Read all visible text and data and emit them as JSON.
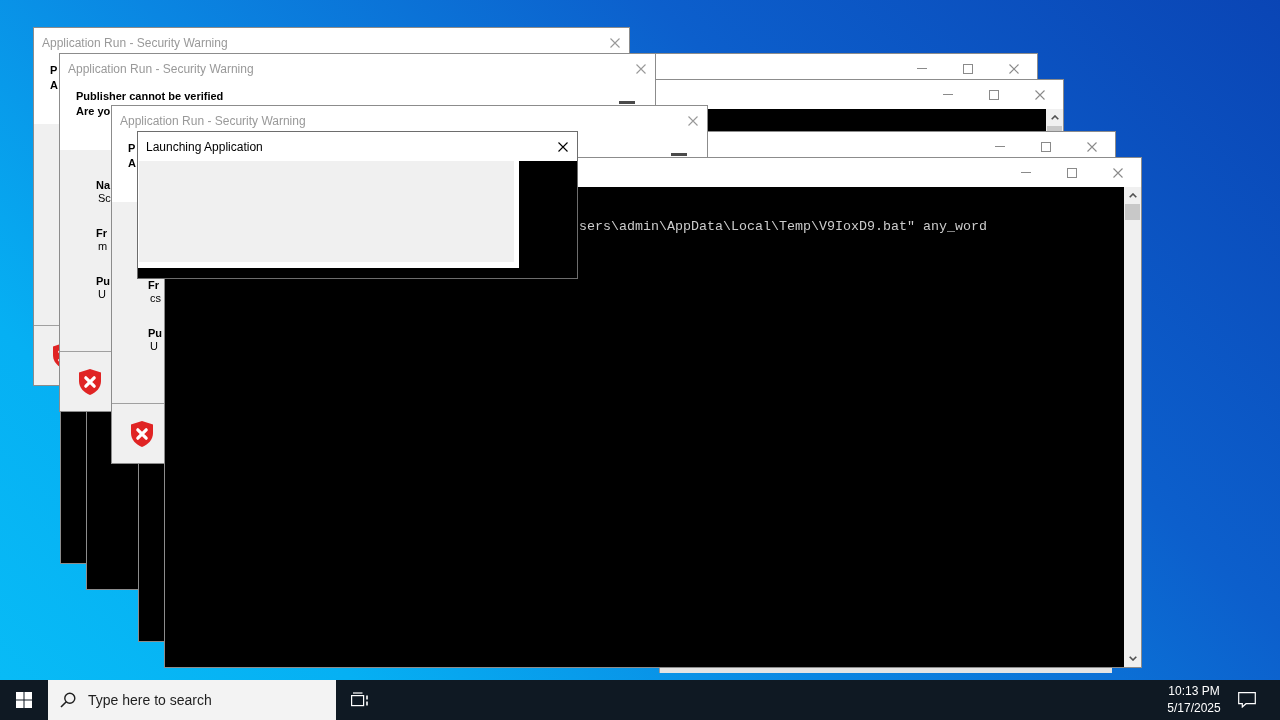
{
  "desktop": {
    "windows": [
      {
        "kind": "security_warning",
        "title": "Application Run - Security Warning",
        "active": false,
        "heading": [
          "P",
          "A"
        ]
      },
      {
        "kind": "console"
      },
      {
        "kind": "console"
      },
      {
        "kind": "security_warning",
        "title": "Application Run - Security Warning",
        "active": false,
        "heading": [
          "Publisher cannot be verified",
          "Are yo"
        ],
        "fields": [
          {
            "label": "Na",
            "value": "Sc"
          },
          {
            "label": "Fr",
            "value": "m"
          },
          {
            "label": "Pu",
            "value": "U"
          }
        ]
      },
      {
        "kind": "console"
      },
      {
        "kind": "security_warning",
        "title": "Application Run - Security Warning",
        "active": false,
        "heading": [
          "P",
          "A"
        ],
        "fields": [
          {
            "label": "Fr",
            "value": "cs"
          },
          {
            "label": "Pu",
            "value": "U"
          }
        ]
      },
      {
        "kind": "console",
        "lines": [
          "sers\\admin\\AppData\\Local\\Temp\\V9IoxD9.bat\" any_word"
        ]
      },
      {
        "kind": "dialog",
        "title": "Launching Application",
        "active": true
      }
    ]
  },
  "taskbar": {
    "search": {
      "placeholder": "Type here to search"
    },
    "clock": {
      "time": "10:13 PM",
      "date": "5/17/2025"
    }
  }
}
